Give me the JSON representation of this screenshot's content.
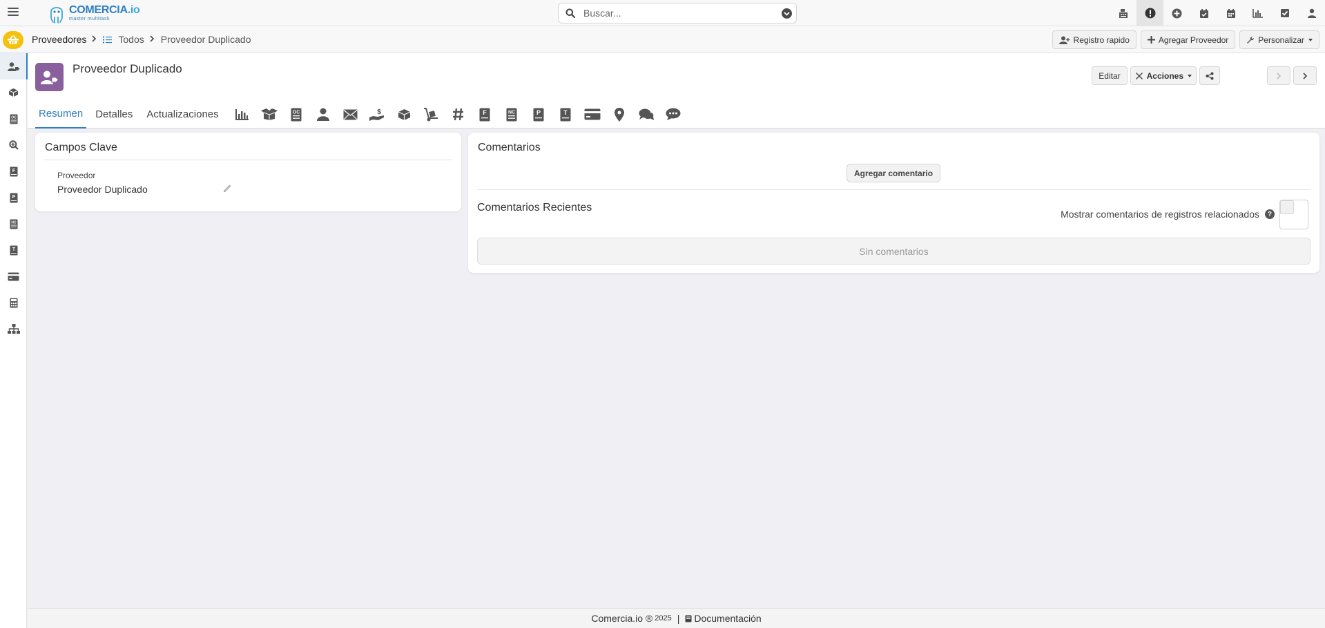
{
  "brand": {
    "name_main": "COMERCIA",
    "name_suffix": ".io",
    "tagline": "master multitask",
    "color": "#2f7fc1"
  },
  "search": {
    "placeholder": "Buscar..."
  },
  "top_icons": [
    "cash-register-icon",
    "alert-icon",
    "plus-circle-icon",
    "calendar-check-icon",
    "calendar-icon",
    "chart-bar-icon",
    "checkbox-icon",
    "user-icon"
  ],
  "breadcrumb": {
    "module": "Proveedores",
    "list": "Todos",
    "current": "Proveedor Duplicado"
  },
  "toolbar": {
    "quick_register": "Registro rapido",
    "add_supplier": "Agregar Proveedor",
    "customize": "Personalizar"
  },
  "record": {
    "title": "Proveedor Duplicado",
    "avatar_color": "#8a5f9e",
    "edit_label": "Editar",
    "actions_label": "Acciones"
  },
  "tabs": [
    {
      "label": "Resumen",
      "active": true
    },
    {
      "label": "Detalles",
      "active": false
    },
    {
      "label": "Actualizaciones",
      "active": false
    }
  ],
  "tab_icons": [
    "chart-bar-icon",
    "box-open-icon",
    "purchase-order-icon",
    "person-icon",
    "envelope-icon",
    "hand-dollar-icon",
    "box-icon",
    "dolly-icon",
    "hashtag-icon",
    "invoice-f-icon",
    "credit-note-icon",
    "document-p-icon",
    "document-t-icon",
    "credit-card-icon",
    "map-pin-icon",
    "comments-icon",
    "comment-dots-icon"
  ],
  "key_fields": {
    "title": "Campos Clave",
    "field_label": "Proveedor",
    "field_value": "Proveedor Duplicado"
  },
  "comments": {
    "title": "Comentarios",
    "add_button": "Agregar comentario",
    "recent_title": "Comentarios Recientes",
    "related_label": "Mostrar comentarios de registros relacionados",
    "empty_text": "Sin comentarios"
  },
  "footer": {
    "brand": "Comercia.io ®",
    "year": "2025",
    "separator": "|",
    "docs": "Documentación"
  }
}
